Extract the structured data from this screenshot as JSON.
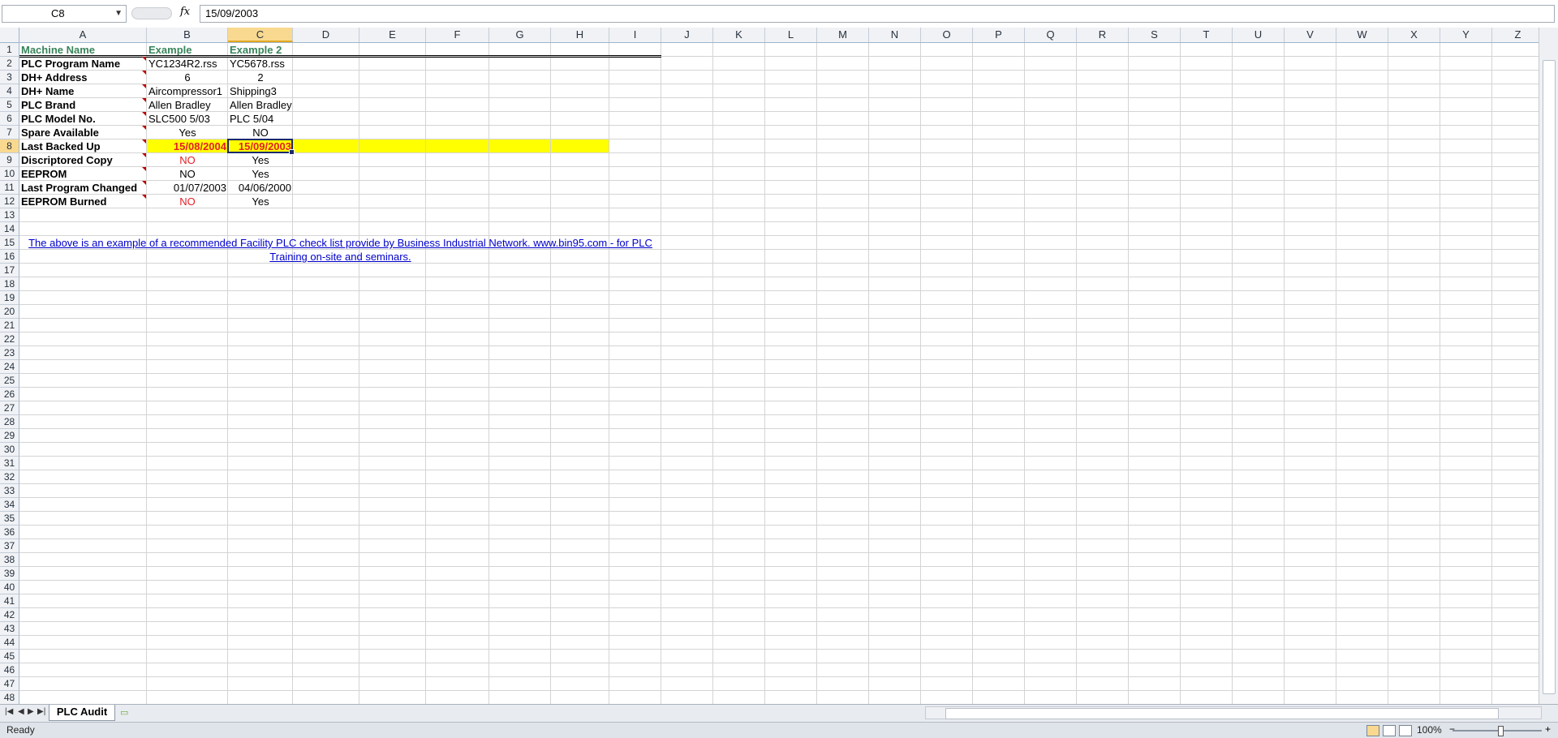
{
  "formula_bar": {
    "name_box": "C8",
    "fx": "fx",
    "value": "15/09/2003"
  },
  "columns": [
    "A",
    "B",
    "C",
    "D",
    "E",
    "F",
    "G",
    "H",
    "I",
    "J",
    "K",
    "L",
    "M",
    "N",
    "O",
    "P",
    "Q",
    "R",
    "S",
    "T",
    "U",
    "V",
    "W",
    "X",
    "Y",
    "Z"
  ],
  "selected_column": "C",
  "selected_row": 8,
  "rows": [
    "1",
    "2",
    "3",
    "4",
    "5",
    "6",
    "7",
    "8",
    "9",
    "10",
    "11",
    "12",
    "13",
    "14",
    "15",
    "16",
    "17",
    "18",
    "19",
    "20",
    "21",
    "22",
    "23",
    "24",
    "25",
    "26",
    "27",
    "28",
    "29",
    "30",
    "31",
    "32",
    "33",
    "34",
    "35",
    "36",
    "37",
    "38",
    "39",
    "40",
    "41",
    "42",
    "43",
    "44",
    "45",
    "46",
    "47",
    "48"
  ],
  "sheet": {
    "header": {
      "a": "Machine Name",
      "b": "Example",
      "c": "Example 2"
    },
    "records": [
      {
        "a": "PLC Program Name",
        "b": "YC1234R2.rss",
        "c": "YC5678.rss"
      },
      {
        "a": "DH+ Address",
        "b": "6",
        "c": "2"
      },
      {
        "a": "DH+ Name",
        "b": "Aircompressor1",
        "c": "Shipping3"
      },
      {
        "a": "PLC Brand",
        "b": "Allen Bradley",
        "c": "Allen Bradley"
      },
      {
        "a": "PLC Model No.",
        "b": "SLC500 5/03",
        "c": "PLC 5/04"
      },
      {
        "a": "Spare Available",
        "b": "Yes",
        "c": "NO"
      },
      {
        "a": "Last Backed Up",
        "b": "15/08/2004",
        "c": "15/09/2003"
      },
      {
        "a": "Discriptored Copy",
        "b": "NO",
        "c": "Yes"
      },
      {
        "a": "EEPROM",
        "b": "NO",
        "c": "Yes"
      },
      {
        "a": "Last Program Changed",
        "b": "01/07/2003",
        "c": "04/06/2000"
      },
      {
        "a": "EEPROM Burned",
        "b": "NO",
        "c": "Yes"
      }
    ],
    "note_line1": "The above is an example of a recommended Facility PLC check list provide by Business Industrial Network. www.bin95.com - for PLC",
    "note_line2": "Training on-site and seminars."
  },
  "colors": {
    "header_text": "#38845a",
    "highlight": "#ffff00",
    "red_text": "#e31e24",
    "link": "#0000cc"
  },
  "tabs": {
    "active": "PLC Audit"
  },
  "status": {
    "ready": "Ready",
    "zoom": "100%",
    "minus": "−",
    "plus": "+"
  }
}
